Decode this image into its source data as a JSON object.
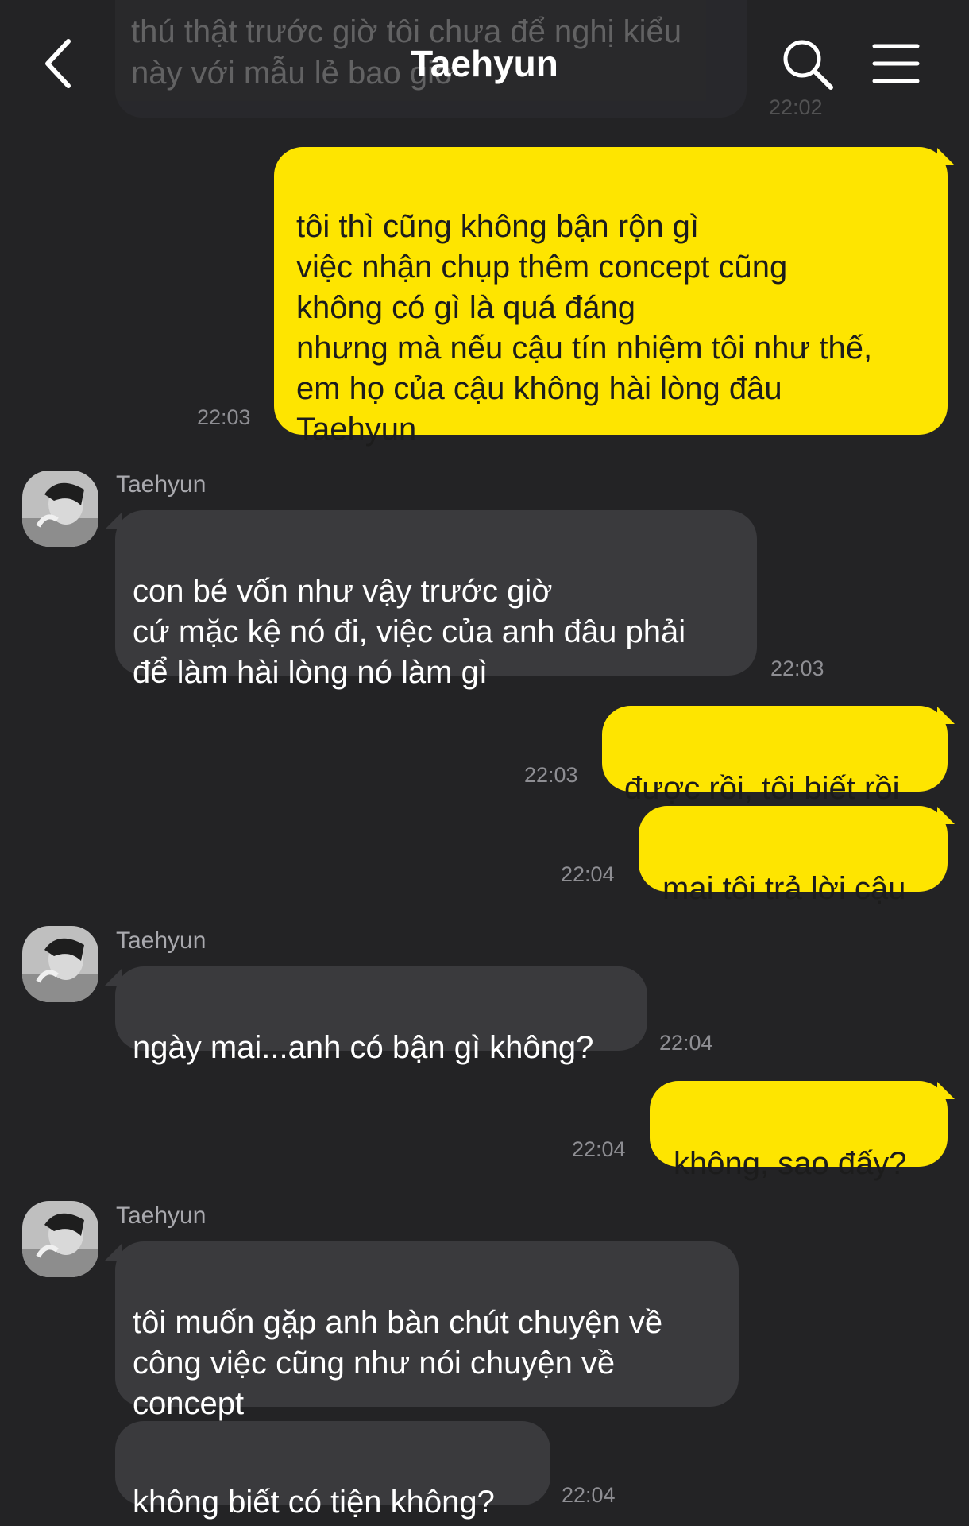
{
  "header": {
    "title": "Taehyun",
    "back_icon": "chevron-left-icon",
    "search_icon": "search-icon",
    "menu_icon": "hamburger-menu-icon"
  },
  "theme": {
    "background": "#232325",
    "outgoing_bubble": "#FEE500",
    "incoming_bubble": "#3a3a3d"
  },
  "messages": [
    {
      "direction": "incoming",
      "text": "thú thật trước giờ tôi chưa để nghị kiểu\nnày với mẫu lẻ bao giờ",
      "time": "22:02"
    },
    {
      "direction": "outgoing",
      "text": "tôi thì cũng không bận rộn gì\nviệc nhận chụp thêm concept cũng\nkhông có gì là quá đáng\nnhưng mà nếu cậu tín nhiệm tôi như thế,\nem họ của cậu không hài lòng đâu\nTaehyun",
      "time": "22:03"
    },
    {
      "direction": "incoming",
      "sender": "Taehyun",
      "text": "con bé vốn như vậy trước giờ\ncứ mặc kệ nó đi, việc của anh đâu phải\nđể làm hài lòng nó làm gì",
      "time": "22:03"
    },
    {
      "direction": "outgoing",
      "text": "được rồi, tôi biết rồi",
      "time": "22:03"
    },
    {
      "direction": "outgoing",
      "text": "mai tôi trả lời cậu",
      "time": "22:04"
    },
    {
      "direction": "incoming",
      "sender": "Taehyun",
      "text": "ngày mai...anh có bận gì không?",
      "time": "22:04"
    },
    {
      "direction": "outgoing",
      "text": "không, sao đấy?",
      "time": "22:04"
    },
    {
      "direction": "incoming",
      "sender": "Taehyun",
      "text": "tôi muốn gặp anh bàn chút chuyện về\ncông việc cũng như nói chuyện về\nconcept"
    },
    {
      "direction": "incoming",
      "text": "không biết có tiện không?",
      "time": "22:04"
    }
  ]
}
